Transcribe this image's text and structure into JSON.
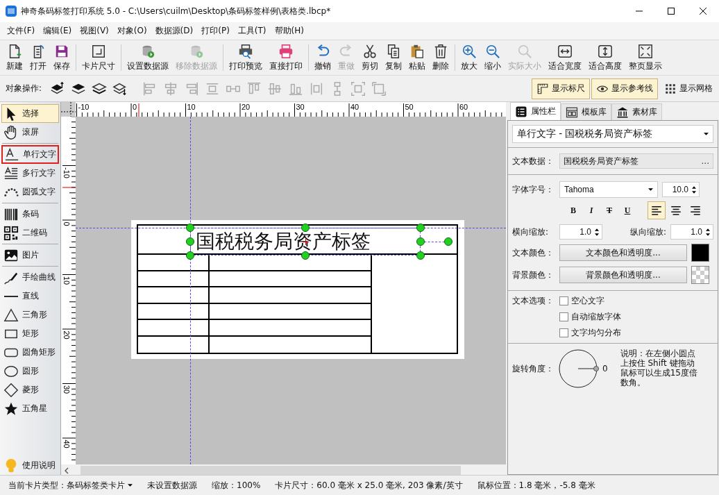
{
  "window": {
    "title": "神奇条码标签打印系统 5.0 - C:\\Users\\cuilm\\Desktop\\条码标签样例\\表格类.lbcp*"
  },
  "menu": [
    "文件(F)",
    "编辑(E)",
    "视图(V)",
    "对象(O)",
    "数据源(D)",
    "打印(P)",
    "工具(T)",
    "帮助(H)"
  ],
  "toolbar": [
    [
      {
        "kind": "new",
        "label": "新建",
        "disabled": false
      },
      {
        "kind": "open",
        "label": "打开",
        "disabled": false
      },
      {
        "kind": "save",
        "label": "保存",
        "disabled": false
      }
    ],
    [
      {
        "kind": "cardsize",
        "label": "卡片尺寸",
        "disabled": false
      }
    ],
    [
      {
        "kind": "db",
        "label": "设置数据源",
        "disabled": false
      },
      {
        "kind": "db",
        "label": "移除数据源",
        "disabled": true
      }
    ],
    [
      {
        "kind": "preview",
        "label": "打印预览",
        "disabled": false
      },
      {
        "kind": "print",
        "label": "直接打印",
        "disabled": false
      }
    ],
    [
      {
        "kind": "undo",
        "label": "撤销",
        "disabled": false
      },
      {
        "kind": "redo",
        "label": "重做",
        "disabled": true
      },
      {
        "kind": "cut",
        "label": "剪切",
        "disabled": false
      },
      {
        "kind": "copy",
        "label": "复制",
        "disabled": false
      },
      {
        "kind": "paste",
        "label": "粘贴",
        "disabled": false
      },
      {
        "kind": "trash",
        "label": "删除",
        "disabled": false
      }
    ],
    [
      {
        "kind": "zoomin",
        "label": "放大",
        "disabled": false
      },
      {
        "kind": "zoomout",
        "label": "缩小",
        "disabled": false
      },
      {
        "kind": "zoom",
        "label": "实际大小",
        "disabled": true
      },
      {
        "kind": "fitw",
        "label": "适合宽度",
        "disabled": false
      },
      {
        "kind": "fith",
        "label": "适合高度",
        "disabled": false
      },
      {
        "kind": "fitp",
        "label": "整页显示",
        "disabled": false
      }
    ]
  ],
  "object_bar": {
    "label": "对象操作:"
  },
  "view_toggles": [
    {
      "kind": "ruler",
      "label": "显示标尺",
      "on": true
    },
    {
      "kind": "eye",
      "label": "显示参考线",
      "on": true
    },
    {
      "kind": "grid",
      "label": "显示网格",
      "on": false
    }
  ],
  "tools": [
    [
      {
        "kind": "pointer",
        "label": "选择",
        "selected": true,
        "outlined": false
      },
      {
        "kind": "hand",
        "label": "滚屏",
        "selected": false,
        "outlined": false
      }
    ],
    [
      {
        "kind": "text",
        "label": "单行文字",
        "selected": false,
        "outlined": true
      },
      {
        "kind": "mtext",
        "label": "多行文字",
        "selected": false,
        "outlined": false
      },
      {
        "kind": "arc",
        "label": "圆弧文字",
        "selected": false,
        "outlined": false
      }
    ],
    [
      {
        "kind": "barcode",
        "label": "条码",
        "selected": false,
        "outlined": false
      },
      {
        "kind": "qr",
        "label": "二维码",
        "selected": false,
        "outlined": false
      }
    ],
    [
      {
        "kind": "image",
        "label": "图片",
        "selected": false,
        "outlined": false
      }
    ],
    [
      {
        "kind": "pen",
        "label": "手绘曲线",
        "selected": false,
        "outlined": false
      },
      {
        "kind": "line",
        "label": "直线",
        "selected": false,
        "outlined": false
      },
      {
        "kind": "triangle",
        "label": "三角形",
        "selected": false,
        "outlined": false
      },
      {
        "kind": "rect",
        "label": "矩形",
        "selected": false,
        "outlined": false
      },
      {
        "kind": "rrect",
        "label": "圆角矩形",
        "selected": false,
        "outlined": false
      },
      {
        "kind": "ellipse",
        "label": "圆形",
        "selected": false,
        "outlined": false
      },
      {
        "kind": "diamond",
        "label": "菱形",
        "selected": false,
        "outlined": false
      },
      {
        "kind": "star",
        "label": "五角星",
        "selected": false,
        "outlined": false
      }
    ]
  ],
  "help": {
    "label": "使用说明"
  },
  "rulers": {
    "horizontal": [
      "-10",
      "0",
      "10",
      "20",
      "30",
      "40",
      "50",
      "60"
    ],
    "vertical": [
      "-10",
      "0",
      "10",
      "20",
      "30",
      "40"
    ]
  },
  "canvas": {
    "label_text": "国税税务局资产标签"
  },
  "panel": {
    "tabs": [
      {
        "kind": "list",
        "label": "属性栏",
        "selected": true
      },
      {
        "kind": "template",
        "label": "模板库",
        "selected": false
      },
      {
        "kind": "bank",
        "label": "素材库",
        "selected": false
      }
    ],
    "object_select": "单行文字 - 国税税务局资产标签",
    "text_data_label": "文本数据：",
    "text_data": "国税税务局资产标签",
    "more": "...",
    "font_label": "字体字号：",
    "font": "Tahoma",
    "size": "10.0",
    "format_buttons": [
      {
        "kind": "bold",
        "label": "B"
      },
      {
        "kind": "italic",
        "label": "I"
      },
      {
        "kind": "strike",
        "label": "T"
      },
      {
        "kind": "underline",
        "label": "U"
      }
    ],
    "align_buttons": [
      {
        "kind": "left",
        "selected": true
      },
      {
        "kind": "center",
        "selected": false
      },
      {
        "kind": "right",
        "selected": false
      }
    ],
    "hscale_label": "横向缩放:",
    "hscale": "1.0",
    "vscale_label": "纵向缩放:",
    "vscale": "1.0",
    "text_color_label": "文本颜色：",
    "text_color_button": "文本颜色和透明度...",
    "bg_color_label": "背景颜色：",
    "bg_color_button": "背景颜色和透明度...",
    "options_label": "文本选项：",
    "options": [
      {
        "label": "空心文字",
        "checked": false
      },
      {
        "label": "自动缩放字体",
        "checked": false
      },
      {
        "label": "文字均匀分布",
        "checked": false
      }
    ],
    "rotation_label": "旋转角度：",
    "rotation": "0",
    "note": "说明：在左侧小圆点上按住 Shift 键拖动鼠标可以生成15度倍数角。"
  },
  "status_bar": [
    {
      "kind": "dropdown",
      "text": "当前卡片类型：条码标签类卡片"
    },
    {
      "kind": "plain",
      "text": "未设置数据源"
    },
    {
      "kind": "plain",
      "text": "缩放：100%"
    },
    {
      "kind": "plain",
      "text": "卡片尺寸：60.0 毫米 x 25.0 毫米, 203 像素/英寸"
    },
    {
      "kind": "plain",
      "text": "鼠标位置：1.8 毫米，-5.8 毫米"
    }
  ]
}
